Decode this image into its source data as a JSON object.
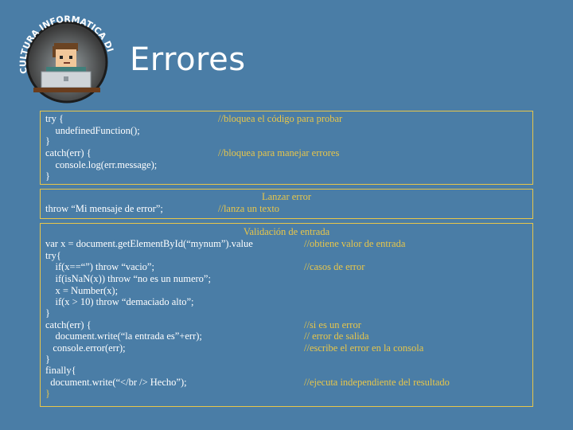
{
  "logo": {
    "arc_text": "CULTURA INFORMATICA DIGITAL"
  },
  "title": "Errores",
  "box1": {
    "lines": [
      "try {",
      "    undefinedFunction();",
      "}",
      "catch(err) {",
      "    console.log(err.message);",
      "}"
    ],
    "comments": [
      "//bloquea el código para probar",
      "//bloquea para manejar errores"
    ]
  },
  "box2": {
    "heading": "Lanzar error",
    "code": "throw “Mi mensaje de error”;",
    "comment": "//lanza un texto"
  },
  "box3": {
    "heading": "Validación de entrada",
    "lines": [
      "var x = document.getElementById(“mynum”).value",
      "try{",
      "    if(x==“”) throw “vacio”;",
      "    if(isNaN(x)) throw “no es un numero”;",
      "    x = Number(x);",
      "    if(x > 10) throw “demaciado alto”;",
      "}",
      "catch(err) {",
      "    document.write(“la entrada es”+err);",
      "   console.error(err);",
      "}",
      "finally{",
      "  document.write(“</br /> Hecho”);",
      "}"
    ],
    "comments": [
      "//obtiene valor de entrada",
      "//casos de error",
      "//si es un error",
      "// error de salida",
      "//escribe el error en la consola",
      "//ejecuta independiente del resultado"
    ]
  },
  "colors": {
    "background": "#4a7da6",
    "accent": "#e8c64a",
    "text": "#ffffff"
  }
}
